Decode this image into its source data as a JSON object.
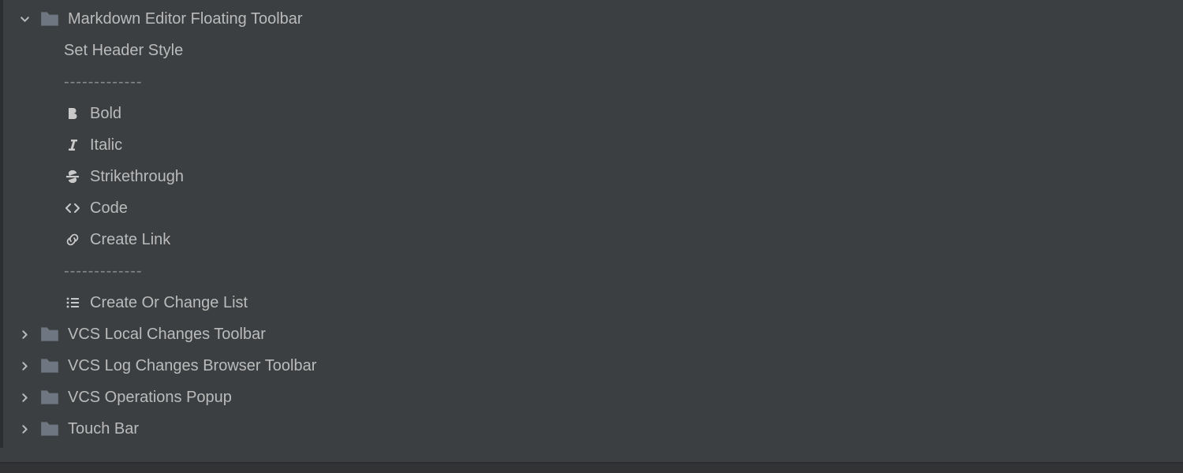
{
  "tree": {
    "expanded": {
      "label": "Markdown Editor Floating Toolbar",
      "children": [
        {
          "label": "Set Header Style",
          "icon": null
        },
        {
          "label": "-------------",
          "separator": true
        },
        {
          "label": "Bold",
          "icon": "bold"
        },
        {
          "label": "Italic",
          "icon": "italic"
        },
        {
          "label": "Strikethrough",
          "icon": "strikethrough"
        },
        {
          "label": "Code",
          "icon": "code"
        },
        {
          "label": "Create Link",
          "icon": "link"
        },
        {
          "label": "-------------",
          "separator": true
        },
        {
          "label": "Create Or Change List",
          "icon": "list"
        }
      ]
    },
    "collapsed": [
      {
        "label": "VCS Local Changes Toolbar"
      },
      {
        "label": "VCS Log Changes Browser Toolbar"
      },
      {
        "label": "VCS Operations Popup"
      },
      {
        "label": "Touch Bar"
      }
    ]
  }
}
